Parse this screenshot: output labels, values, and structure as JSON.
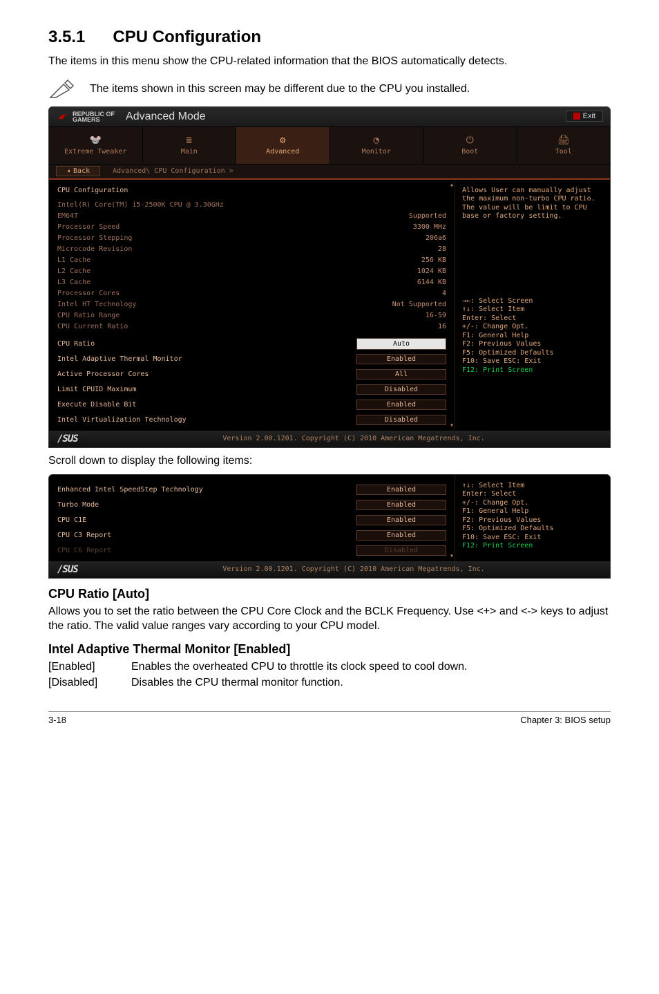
{
  "section": {
    "number": "3.5.1",
    "title": "CPU Configuration"
  },
  "intro": "The items in this menu show the CPU-related information that the BIOS automatically detects.",
  "note": "The items shown in this screen may be different due to the CPU you installed.",
  "bios1": {
    "titlebar": {
      "brand_top": "REPUBLIC OF",
      "brand_bottom": "GAMERS",
      "mode": "Advanced Mode",
      "exit": "Exit"
    },
    "tabs": [
      {
        "icon": "🐭",
        "label": "Extreme Tweaker"
      },
      {
        "icon": "≣",
        "label": "Main"
      },
      {
        "icon": "⚙",
        "label": "Advanced",
        "active": true,
        "name": "tab-advanced-icon"
      },
      {
        "icon": "◔",
        "label": "Monitor"
      },
      {
        "icon": "⏻",
        "label": "Boot"
      },
      {
        "icon": "🖨",
        "label": "Tool"
      }
    ],
    "back": "Back",
    "breadcrumb": "Advanced\\ CPU Configuration >",
    "heading": "CPU Configuration",
    "info_rows": [
      {
        "label": "Intel(R) Core(TM) i5-2500K CPU @ 3.30GHz",
        "value": ""
      },
      {
        "label": "EM64T",
        "value": "Supported"
      },
      {
        "label": "Processor Speed",
        "value": "3300 MHz"
      },
      {
        "label": "Processor Stepping",
        "value": "206a6"
      },
      {
        "label": "Microcode Revision",
        "value": "28"
      },
      {
        "label": "L1 Cache",
        "value": "256 KB"
      },
      {
        "label": "L2 Cache",
        "value": "1024 KB"
      },
      {
        "label": "L3 Cache",
        "value": "6144 KB"
      },
      {
        "label": "Processor Cores",
        "value": "4"
      },
      {
        "label": "Intel HT Technology",
        "value": "Not Supported"
      },
      {
        "label": "CPU Ratio Range",
        "value": "16-59"
      },
      {
        "label": "CPU Current Ratio",
        "value": "16"
      }
    ],
    "setting_rows": [
      {
        "label": "CPU Ratio",
        "value": "Auto",
        "selected": true
      },
      {
        "label": "Intel Adaptive Thermal Monitor",
        "value": "Enabled"
      },
      {
        "label": "Active Processor Cores",
        "value": "All"
      },
      {
        "label": "Limit CPUID Maximum",
        "value": "Disabled"
      },
      {
        "label": "Execute Disable Bit",
        "value": "Enabled"
      },
      {
        "label": "Intel Virtualization Technology",
        "value": "Disabled"
      }
    ],
    "help_text": "Allows User can manually adjust the maximum non-turbo CPU ratio. The value will be limit to CPU base or factory setting.",
    "keyhelp": [
      {
        "text": "→←: Select Screen"
      },
      {
        "text": "↑↓: Select Item"
      },
      {
        "text": "Enter: Select"
      },
      {
        "text": "+/-: Change Opt."
      },
      {
        "text": "F1: General Help"
      },
      {
        "text": "F2: Previous Values"
      },
      {
        "text": "F5: Optimized Defaults"
      },
      {
        "text": "F10: Save  ESC: Exit"
      },
      {
        "text": "F12: Print Screen",
        "green": true
      }
    ],
    "version": "Version 2.00.1201. Copyright (C) 2010 American Megatrends, Inc."
  },
  "scroll_note": "Scroll down to display the following items:",
  "bios2": {
    "setting_rows": [
      {
        "label": "Enhanced Intel SpeedStep Technology",
        "value": "Enabled"
      },
      {
        "label": "Turbo Mode",
        "value": "Enabled"
      },
      {
        "label": "CPU C1E",
        "value": "Enabled"
      },
      {
        "label": "CPU C3 Report",
        "value": "Enabled",
        "selected_dark": true
      },
      {
        "label": "CPU C6 Report",
        "value": "Disabled",
        "dim": true
      }
    ],
    "keyhelp": [
      {
        "text": "↑↓: Select Item"
      },
      {
        "text": "Enter: Select"
      },
      {
        "text": "+/-: Change Opt."
      },
      {
        "text": "F1: General Help"
      },
      {
        "text": "F2: Previous Values"
      },
      {
        "text": "F5: Optimized Defaults"
      },
      {
        "text": "F10: Save  ESC: Exit"
      },
      {
        "text": "F12: Print Screen",
        "green": true
      }
    ],
    "version": "Version 2.00.1201. Copyright (C) 2010 American Megatrends, Inc."
  },
  "sub1": {
    "title": "CPU Ratio [Auto]",
    "desc": "Allows you to set the ratio between the CPU Core Clock and the BCLK Frequency. Use <+> and <-> keys to adjust the ratio. The valid value ranges vary according to your CPU model."
  },
  "sub2": {
    "title": "Intel Adaptive Thermal Monitor [Enabled]",
    "options": [
      {
        "key": "[Enabled]",
        "val": "Enables the overheated CPU to throttle its clock speed to cool down."
      },
      {
        "key": "[Disabled]",
        "val": "Disables the CPU thermal monitor function."
      }
    ]
  },
  "footer": {
    "left": "3-18",
    "right": "Chapter 3: BIOS setup"
  }
}
